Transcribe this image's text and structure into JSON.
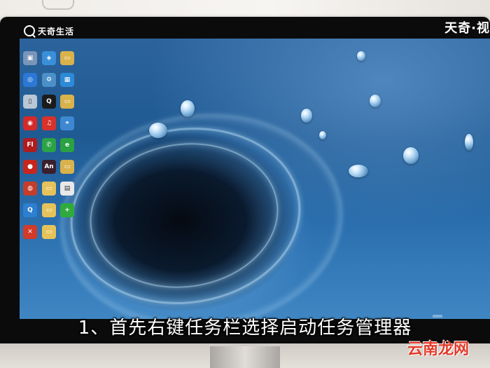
{
  "channel": {
    "name": "天奇生活"
  },
  "brand": {
    "text": "天奇·视"
  },
  "subtitle": "1、首先右键任务栏选择启动任务管理器",
  "watermark": "云南龙网",
  "desktop": {
    "columns": [
      [
        {
          "icon": "computer-icon",
          "color": "#7a95b8",
          "glyph": "▣",
          "label": ""
        },
        {
          "icon": "browser-icon",
          "color": "#2b78d6",
          "glyph": "◎",
          "label": ""
        },
        {
          "icon": "trash-icon",
          "color": "#b9c6d4",
          "glyph": "▯",
          "label": ""
        },
        {
          "icon": "app-red-icon",
          "color": "#d42a2a",
          "glyph": "◉",
          "label": ""
        },
        {
          "icon": "flash-icon",
          "color": "#b01c1c",
          "glyph": "Fl",
          "label": ""
        },
        {
          "icon": "recorder-icon",
          "color": "#c8261c",
          "glyph": "●",
          "label": ""
        },
        {
          "icon": "app-red2-icon",
          "color": "#c43d2a",
          "glyph": "◍",
          "label": ""
        },
        {
          "icon": "quicktime-icon",
          "color": "#2d7fd1",
          "glyph": "Q",
          "label": ""
        },
        {
          "icon": "xmind-icon",
          "color": "#d23a2a",
          "glyph": "✕",
          "label": ""
        }
      ],
      [
        {
          "icon": "network-icon",
          "color": "#3a8fd9",
          "glyph": "◈",
          "label": ""
        },
        {
          "icon": "control-panel-icon",
          "color": "#4b90c9",
          "glyph": "⚙",
          "label": ""
        },
        {
          "icon": "qq-icon",
          "color": "#1b1b1b",
          "glyph": "Q",
          "label": ""
        },
        {
          "icon": "music-icon",
          "color": "#d8322a",
          "glyph": "♫",
          "label": ""
        },
        {
          "icon": "wechat-icon",
          "color": "#2ba346",
          "glyph": "✆",
          "label": ""
        },
        {
          "icon": "animate-icon",
          "color": "#3a1f2d",
          "glyph": "An",
          "label": ""
        },
        {
          "icon": "folder-icon",
          "color": "#e5c35a",
          "glyph": "▭",
          "label": ""
        },
        {
          "icon": "folder-icon",
          "color": "#e5c35a",
          "glyph": "▭",
          "label": ""
        },
        {
          "icon": "folder-icon",
          "color": "#e5c35a",
          "glyph": "▭",
          "label": ""
        }
      ],
      [
        {
          "icon": "folder-icon",
          "color": "#d9b24c",
          "glyph": "▭",
          "label": ""
        },
        {
          "icon": "tiles-icon",
          "color": "#2d8ad6",
          "glyph": "▦",
          "label": ""
        },
        {
          "icon": "folder-icon",
          "color": "#d9b24c",
          "glyph": "▭",
          "label": ""
        },
        {
          "icon": "link-icon",
          "color": "#3d88d1",
          "glyph": "⚭",
          "label": ""
        },
        {
          "icon": "ie-icon",
          "color": "#2aa142",
          "glyph": "e",
          "label": ""
        },
        {
          "icon": "folder-icon",
          "color": "#d9b24c",
          "glyph": "▭",
          "label": ""
        },
        {
          "icon": "document-icon",
          "color": "#e8e8e8",
          "glyph": "▤",
          "label": ""
        },
        {
          "icon": "add-icon",
          "color": "#2faa3c",
          "glyph": "+",
          "label": ""
        },
        {
          "icon": "",
          "color": "",
          "glyph": "",
          "label": ""
        }
      ]
    ]
  }
}
